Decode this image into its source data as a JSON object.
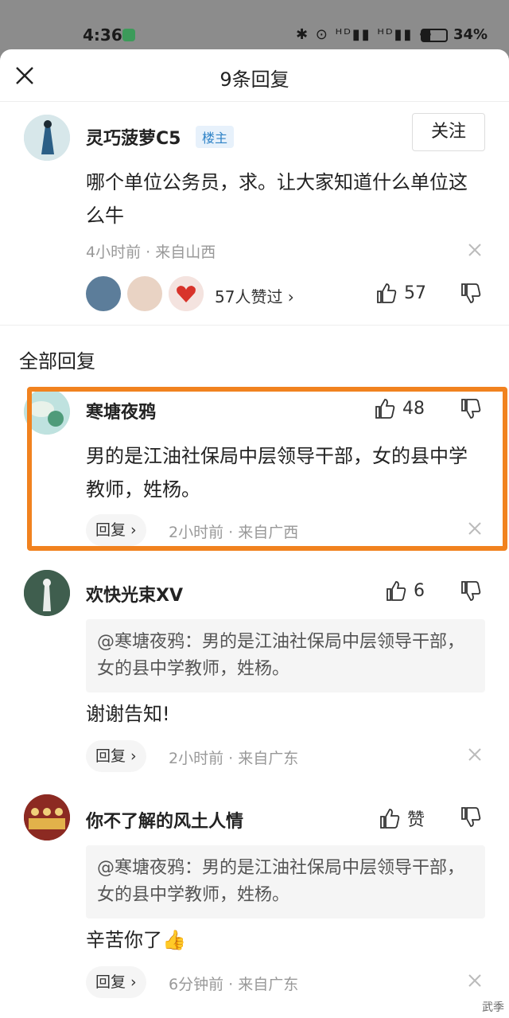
{
  "status_bar": {
    "time": "4:36",
    "icons": "✱ ⊙ ᴴᴰ▮▮ ᴴᴰ▮▮ ◠",
    "battery": "34%"
  },
  "header": {
    "title": "9条回复"
  },
  "main_comment": {
    "user": "灵巧菠萝C5",
    "badge": "楼主",
    "follow": "关注",
    "text": "哪个单位公务员，求。让大家知道什么单位这么牛",
    "meta": "4小时前 · 来自山西",
    "likers": "57人赞过 ›",
    "likes": "57"
  },
  "section_title": "全部回复",
  "replies": [
    {
      "user": "寒塘夜鸦",
      "likes": "48",
      "text": "男的是江油社保局中层领导干部，女的县中学教师，姓杨。",
      "reply": "回复 ›",
      "meta": "2小时前 · 来自广西"
    },
    {
      "user": "欢快光束XV",
      "likes": "6",
      "quote": "@寒塘夜鸦：男的是江油社保局中层领导干部，女的县中学教师，姓杨。",
      "text": "谢谢告知!",
      "reply": "回复 ›",
      "meta": "2小时前 · 来自广东"
    },
    {
      "user": "你不了解的风土人情",
      "likes": "赞",
      "quote": "@寒塘夜鸦：男的是江油社保局中层领导干部，女的县中学教师，姓杨。",
      "text": "辛苦你了👍",
      "reply": "回复 ›",
      "meta": "6分钟前 · 来自广东"
    }
  ],
  "watermark": "武季"
}
